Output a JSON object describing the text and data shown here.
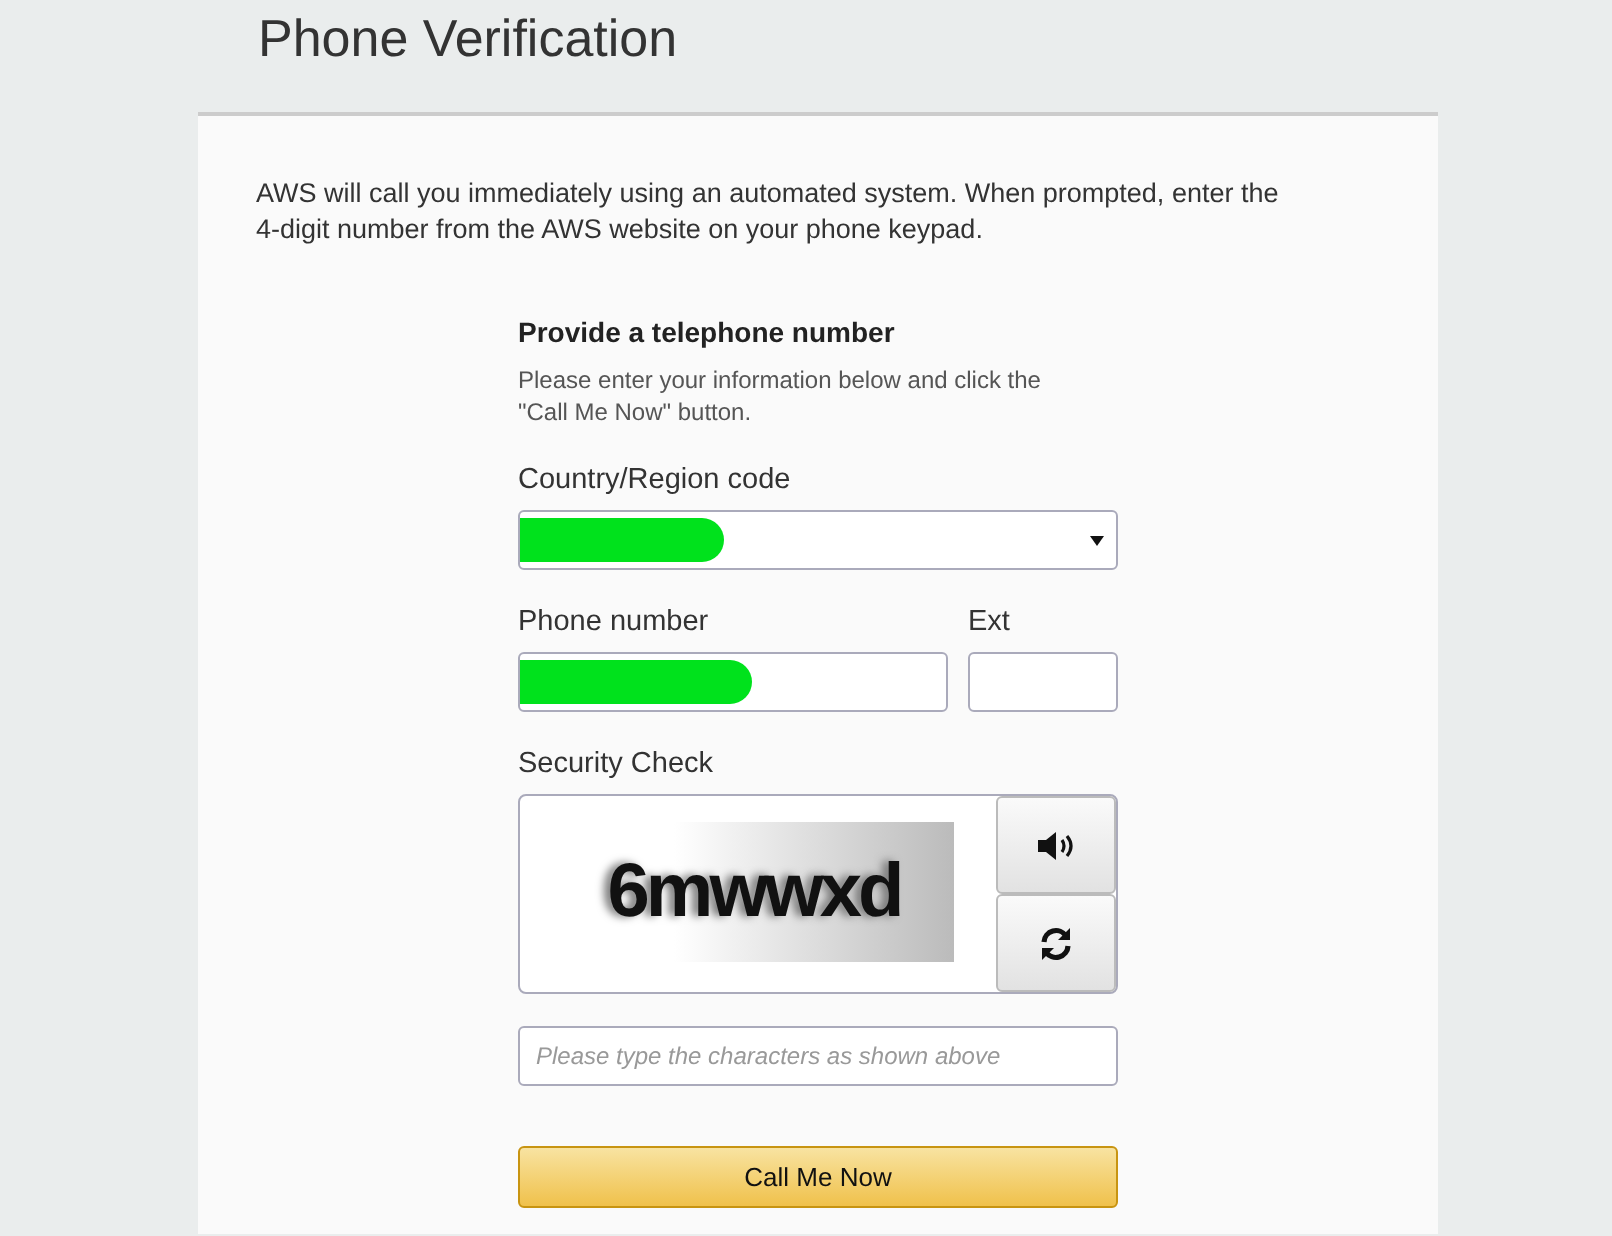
{
  "page": {
    "title": "Phone Verification"
  },
  "intro": "AWS will call you immediately using an automated system. When prompted, enter the 4-digit number from the AWS website on your phone keypad.",
  "form": {
    "heading": "Provide a telephone number",
    "hint": "Please enter your information below and click the \"Call Me Now\" button.",
    "country": {
      "label": "Country/Region code",
      "redacted": true
    },
    "phone": {
      "label": "Phone number",
      "redacted": true
    },
    "ext": {
      "label": "Ext"
    },
    "security": {
      "label": "Security Check",
      "captcha": "6mwwxd",
      "placeholder": "Please type the characters as shown above"
    },
    "button": "Call Me Now"
  }
}
